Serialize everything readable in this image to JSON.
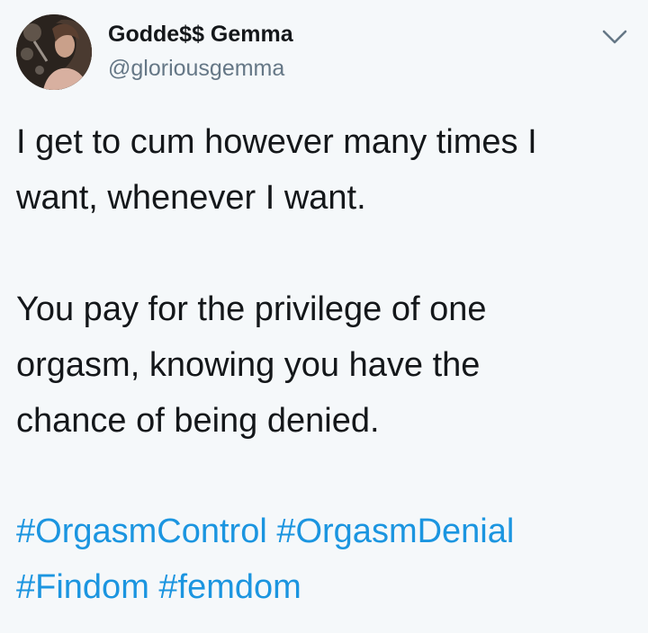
{
  "user": {
    "display_name": "Godde$$ Gemma",
    "handle": "@gloriousgemma",
    "avatar": "avatar-photo"
  },
  "menu": {
    "icon": "chevron-down-icon"
  },
  "tweet": {
    "paragraphs": [
      "I get to cum however many times I\nwant, whenever I want.",
      "You pay for the privilege of one\norgasm, knowing you have the\nchance of being denied."
    ],
    "hashtags": [
      "#OrgasmControl",
      "#OrgasmDenial",
      "#Findom",
      "#femdom"
    ]
  },
  "colors": {
    "background": "#f5f8fa",
    "text": "#14171a",
    "secondary_text": "#657786",
    "link": "#1b95e0"
  }
}
